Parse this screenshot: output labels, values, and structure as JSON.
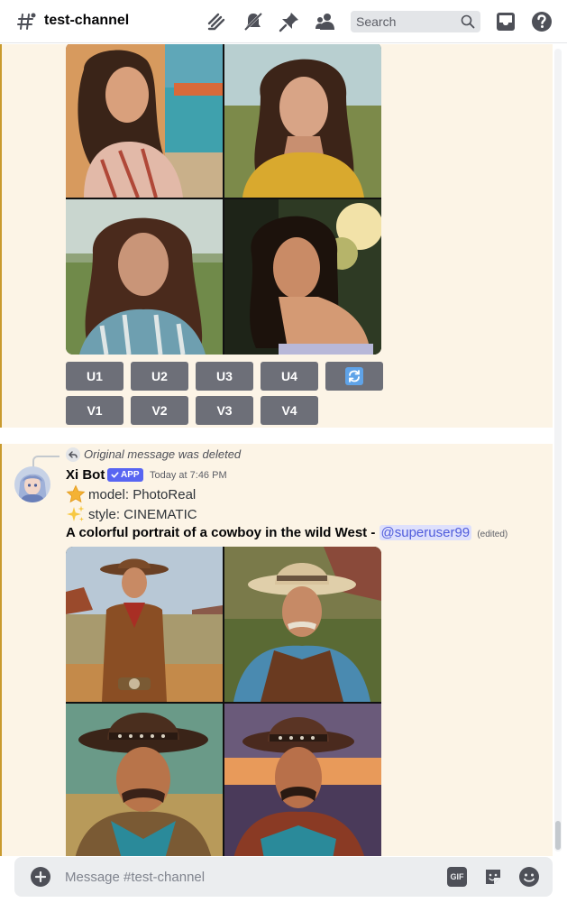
{
  "header": {
    "channel_name": "test-channel",
    "search_placeholder": "Search",
    "icons": [
      "threads-icon",
      "mute-icon",
      "pin-icon",
      "members-icon",
      "search-icon",
      "inbox-icon",
      "help-icon"
    ]
  },
  "first_message": {
    "buttons_row1": [
      "U1",
      "U2",
      "U3",
      "U4"
    ],
    "reroll_icon": "refresh-icon",
    "buttons_row2": [
      "V1",
      "V2",
      "V3",
      "V4"
    ]
  },
  "second_message": {
    "reply_text": "Original message was deleted",
    "author": "Xi Bot",
    "badge": "APP",
    "timestamp": "Today at 7:46 PM",
    "model_line": "model: PhotoReal",
    "style_line": "style: CINEMATIC",
    "prompt_text": "A colorful portrait of a cowboy in the wild West - ",
    "mention": "@superuser99",
    "edited": "(edited)"
  },
  "composer": {
    "placeholder": "Message #test-channel",
    "gif_label": "GIF"
  },
  "colors": {
    "highlight_bg": "#fcf4e6",
    "highlight_border": "#c99a2e",
    "button_gray": "#6d6f78",
    "reroll_blue": "#5fa3e8",
    "badge_blurple": "#5865f2",
    "mention_text": "#505cdc"
  }
}
